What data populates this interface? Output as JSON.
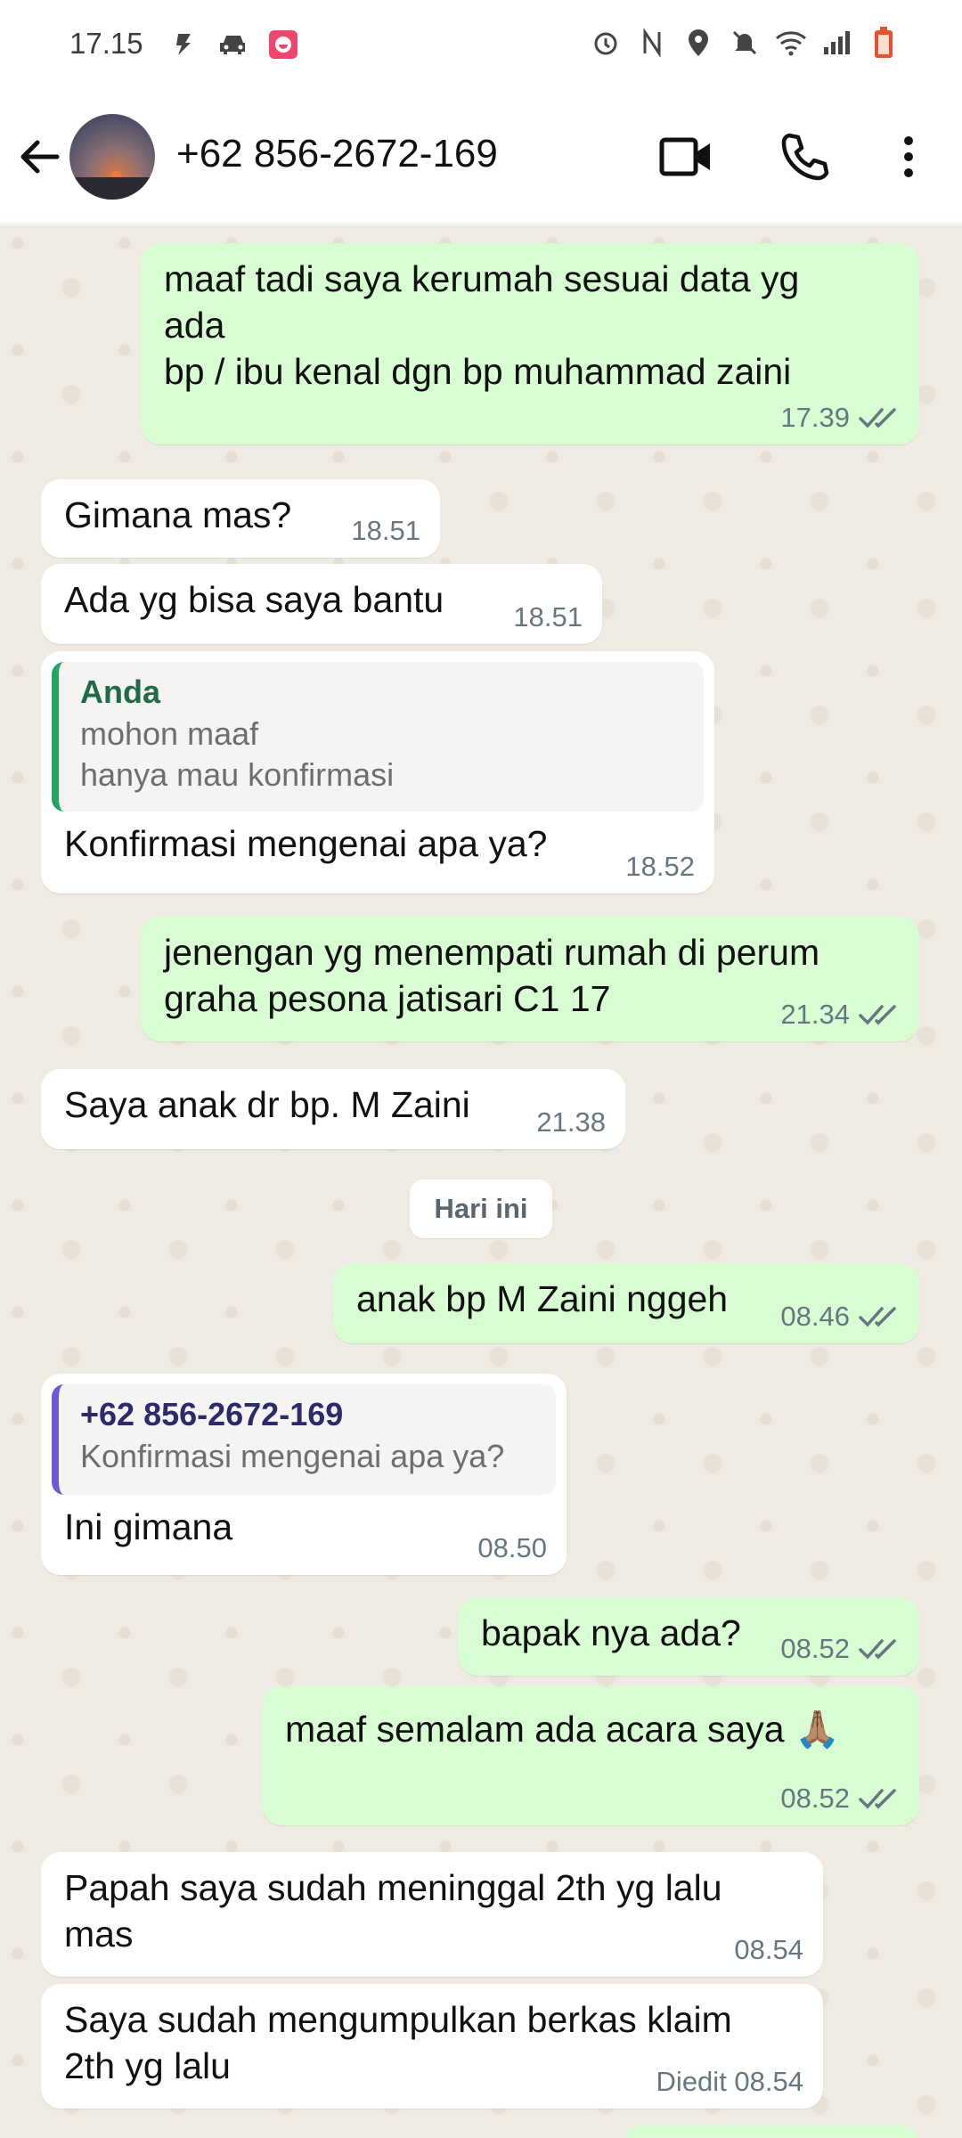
{
  "status_bar": {
    "time": "17.15",
    "icons_left": [
      "flash-icon",
      "car-icon",
      "app-notification-icon"
    ],
    "icons_right": [
      "alarm-icon",
      "nfc-icon",
      "location-icon",
      "mute-icon",
      "wifi-icon",
      "signal-icon",
      "battery-icon"
    ]
  },
  "header": {
    "contact_name": "+62 856-2672-169",
    "actions": [
      "video-call-icon",
      "voice-call-icon",
      "more-options-icon"
    ]
  },
  "colors": {
    "outgoing_bubble": "#d9fdd3",
    "incoming_bubble": "#ffffff",
    "chat_background": "#efeae2",
    "read_ticks": "#53bdeb"
  },
  "messages": [
    {
      "direction": "out",
      "text": "maaf tadi saya kerumah sesuai data yg\nada\nbp / ibu kenal dgn bp muhammad zaini",
      "time": "17.39",
      "status": "read"
    },
    {
      "direction": "in",
      "text": "Gimana mas?",
      "time": "18.51"
    },
    {
      "direction": "in",
      "text": "Ada yg bisa saya bantu",
      "time": "18.51"
    },
    {
      "direction": "in",
      "quote_author": "Anda",
      "quote_text": "mohon maaf\nhanya mau konfirmasi",
      "text": "Konfirmasi mengenai apa ya?",
      "time": "18.52"
    },
    {
      "direction": "out",
      "text": "jenengan yg menempati rumah di perum\ngraha pesona jatisari C1 17",
      "time": "21.34",
      "status": "read"
    },
    {
      "direction": "in",
      "text": "Saya anak dr bp. M Zaini",
      "time": "21.38"
    },
    {
      "direction": "out",
      "text": "anak bp M Zaini nggeh",
      "time": "08.46",
      "status": "read"
    },
    {
      "direction": "in",
      "quote_author": "+62 856-2672-169",
      "quote_text": "Konfirmasi mengenai apa ya?",
      "text": "Ini gimana",
      "time": "08.50"
    },
    {
      "direction": "out",
      "text": "bapak nya ada?",
      "time": "08.52",
      "status": "read"
    },
    {
      "direction": "out",
      "text": "maaf semalam ada acara saya 🙏🏽",
      "time": "08.52",
      "status": "read"
    },
    {
      "direction": "in",
      "text": "Papah saya sudah meninggal 2th yg lalu\nmas",
      "time": "08.54"
    },
    {
      "direction": "in",
      "text": "Saya sudah mengumpulkan berkas klaim\n2th yg lalu",
      "time": "Diedit 08.54"
    }
  ],
  "date_divider": "Hari ini"
}
